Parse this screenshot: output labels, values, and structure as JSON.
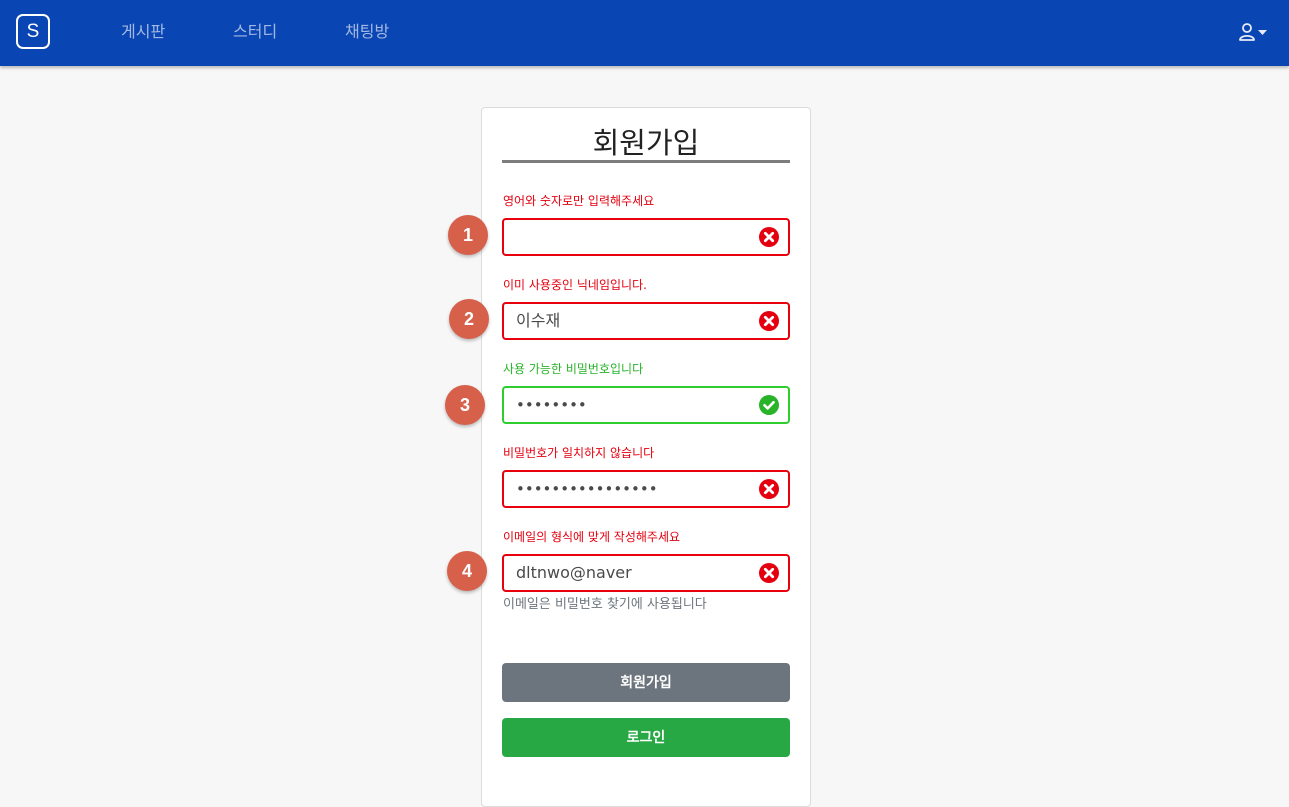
{
  "nav": {
    "brand": "S",
    "links": [
      "게시판",
      "스터디",
      "채팅방"
    ],
    "user_icon": "user-icon",
    "caret_icon": "caret-down-icon"
  },
  "form": {
    "title": "회원가입",
    "fields": [
      {
        "badge": "1",
        "message": "영어와 숫자로만 입력해주세요",
        "status": "error",
        "value": ""
      },
      {
        "badge": "2",
        "message": "이미 사용중인 닉네임입니다.",
        "status": "error",
        "value": "이수재"
      },
      {
        "badge": "3",
        "message": "사용 가능한 비밀번호입니다",
        "status": "valid",
        "value": "••••••••"
      },
      {
        "badge": "",
        "message": "비밀번호가 일치하지 않습니다",
        "status": "error",
        "value": "••••••••••••••••"
      },
      {
        "badge": "4",
        "message": "이메일의 형식에 맞게 작성해주세요",
        "status": "error",
        "value": "dltnwo@naver"
      }
    ],
    "email_help": "이메일은 비밀번호 찾기에 사용됩니다",
    "signup_button": "회원가입",
    "login_button": "로그인"
  },
  "colors": {
    "navbar": "#0a45b4",
    "error": "#e4000f",
    "valid": "#28b329",
    "badge": "#d6604a",
    "signup_button": "#6c757d",
    "login_button": "#28a745"
  }
}
